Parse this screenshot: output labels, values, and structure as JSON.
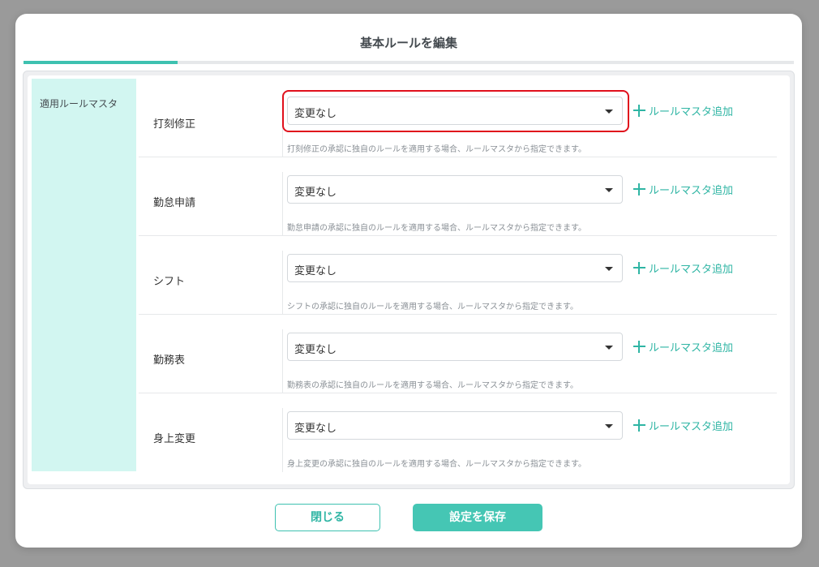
{
  "modal": {
    "title": "基本ルールを編集",
    "section_label": "適用ルールマスタ",
    "accent_color": "#3ec1b0",
    "highlight_color": "#e0101c"
  },
  "rows": [
    {
      "label": "打刻修正",
      "select_value": "変更なし",
      "add_label": "ルールマスタ追加",
      "help": "打刻修正の承認に独自のルールを適用する場合、ルールマスタから指定できます。"
    },
    {
      "label": "勤怠申請",
      "select_value": "変更なし",
      "add_label": "ルールマスタ追加",
      "help": "勤怠申請の承認に独自のルールを適用する場合、ルールマスタから指定できます。"
    },
    {
      "label": "シフト",
      "select_value": "変更なし",
      "add_label": "ルールマスタ追加",
      "help": "シフトの承認に独自のルールを適用する場合、ルールマスタから指定できます。"
    },
    {
      "label": "勤務表",
      "select_value": "変更なし",
      "add_label": "ルールマスタ追加",
      "help": "勤務表の承認に独自のルールを適用する場合、ルールマスタから指定できます。"
    },
    {
      "label": "身上変更",
      "select_value": "変更なし",
      "add_label": "ルールマスタ追加",
      "help": "身上変更の承認に独自のルールを適用する場合、ルールマスタから指定できます。"
    }
  ],
  "footer": {
    "close_label": "閉じる",
    "save_label": "設定を保存"
  }
}
